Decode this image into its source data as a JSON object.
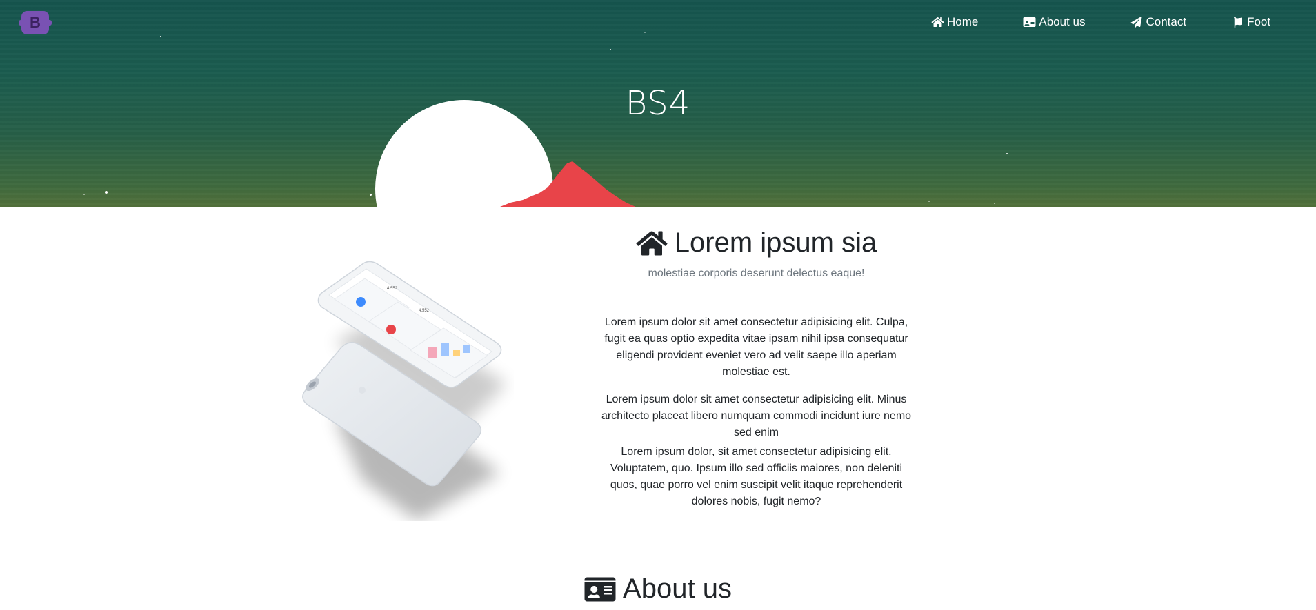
{
  "navbar": {
    "logo_letter": "B",
    "items": [
      {
        "label": "Home",
        "icon": "home-icon"
      },
      {
        "label": "About us",
        "icon": "id-card-icon"
      },
      {
        "label": "Contact",
        "icon": "paper-plane-icon"
      },
      {
        "label": "Foot",
        "icon": "flag-icon"
      }
    ]
  },
  "hero": {
    "title": "BS4"
  },
  "intro_section": {
    "icon": "home-icon",
    "heading": "Lorem ipsum sia",
    "subheading": "molestiae corporis deserunt delectus eaque!",
    "paragraphs": [
      "Lorem ipsum dolor sit amet consectetur adipisicing elit. Culpa, fugit ea quas optio expedita vitae ipsam nihil ipsa consequatur eligendi provident eveniet vero ad velit saepe illo aperiam molestiae est.",
      "Lorem ipsum dolor sit amet consectetur adipisicing elit. Minus architecto placeat libero numquam commodi incidunt iure nemo sed enim",
      "Lorem ipsum dolor, sit amet consectetur adipisicing elit. Voluptatem, quo. Ipsum illo sed officiis maiores, non deleniti quos, quae porro vel enim suscipit velit itaque reprehenderit dolores nobis, fugit nemo?"
    ]
  },
  "phone_mockup": {
    "stat_top": "4,552",
    "stat_bottom": "4,552"
  },
  "about_section": {
    "icon": "id-card-icon",
    "heading": "About us"
  },
  "colors": {
    "hero_top": "#15544e",
    "hero_bottom": "#52703a",
    "logo_bg": "#7952b3",
    "mountain": "#e84449",
    "sun": "#ffffff",
    "text_dark": "#212529",
    "text_muted": "#6c757d"
  }
}
